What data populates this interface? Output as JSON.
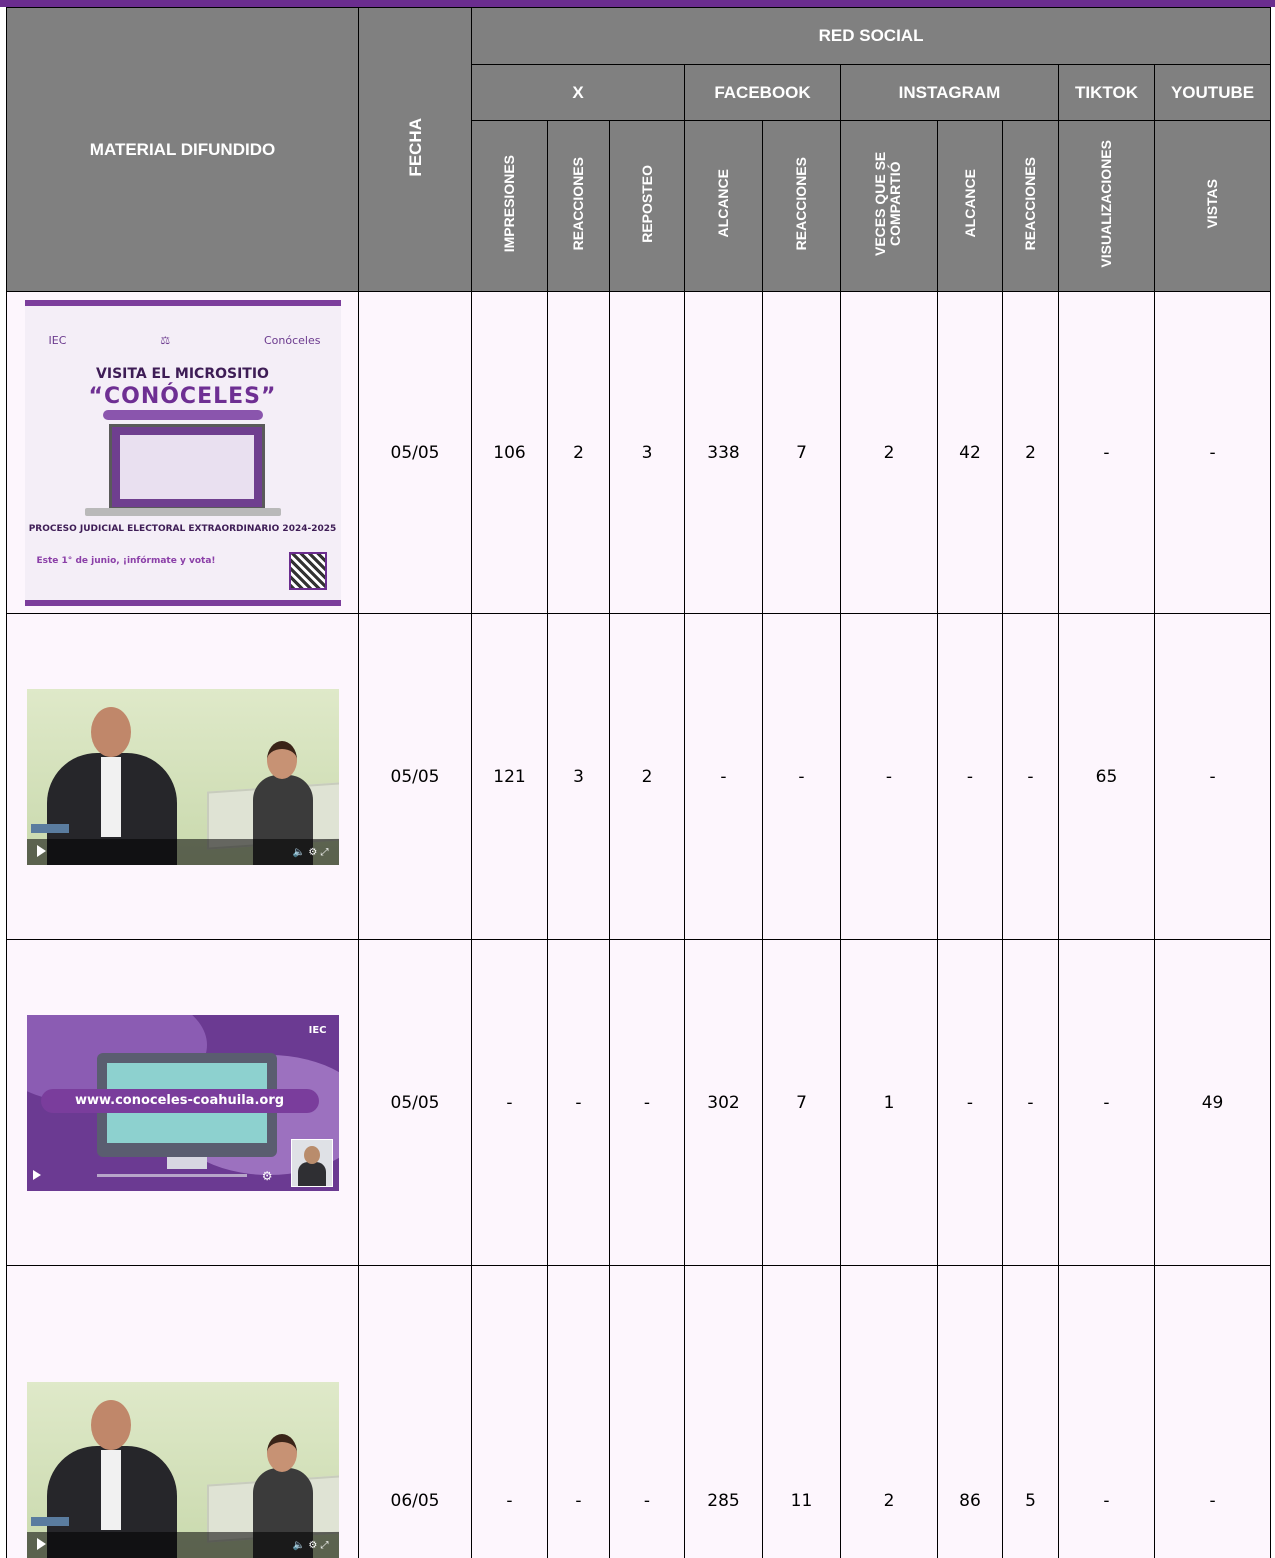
{
  "header": {
    "material": "MATERIAL DIFUNDIDO",
    "fecha": "FECHA",
    "red_social": "RED SOCIAL",
    "networks": {
      "x": "X",
      "facebook": "FACEBOOK",
      "instagram": "INSTAGRAM",
      "tiktok": "TIKTOK",
      "youtube": "YOUTUBE"
    },
    "metrics": {
      "x_impresiones": "IMPRESIONES",
      "x_reacciones": "REACCIONES",
      "x_reposteo": "REPOSTEO",
      "fb_alcance": "ALCANCE",
      "fb_reacciones": "REACCIONES",
      "ig_compartio": "VECES QUE SE COMPARTIÓ",
      "ig_alcance": "ALCANCE",
      "ig_reacciones": "REACCIONES",
      "tt_visualizaciones": "VISUALIZACIONES",
      "yt_vistas": "VISTAS"
    }
  },
  "thumbs": {
    "poster": {
      "logo_iec": "IEC",
      "logo_conoceles": "Conóceles",
      "line1": "VISITA EL MICROSITIO",
      "line2": "“CONÓCELES”",
      "line3": "PROCESO JUDICIAL ELECTORAL EXTRAORDINARIO 2024-2025",
      "line4": "Este 1° de junio, ¡infórmate y vota!"
    },
    "purple_video": {
      "url": "www.conoceles-coahuila.org",
      "logo": "IEC"
    }
  },
  "rows": [
    {
      "fecha": "05/05",
      "x_impresiones": "106",
      "x_reacciones": "2",
      "x_reposteo": "3",
      "fb_alcance": "338",
      "fb_reacciones": "7",
      "ig_compartio": "2",
      "ig_alcance": "42",
      "ig_reacciones": "2",
      "tt_visualizaciones": "-",
      "yt_vistas": "-"
    },
    {
      "fecha": "05/05",
      "x_impresiones": "121",
      "x_reacciones": "3",
      "x_reposteo": "2",
      "fb_alcance": "-",
      "fb_reacciones": "-",
      "ig_compartio": "-",
      "ig_alcance": "-",
      "ig_reacciones": "-",
      "tt_visualizaciones": "65",
      "yt_vistas": "-"
    },
    {
      "fecha": "05/05",
      "x_impresiones": "-",
      "x_reacciones": "-",
      "x_reposteo": "-",
      "fb_alcance": "302",
      "fb_reacciones": "7",
      "ig_compartio": "1",
      "ig_alcance": "-",
      "ig_reacciones": "-",
      "tt_visualizaciones": "-",
      "yt_vistas": "49"
    },
    {
      "fecha": "06/05",
      "x_impresiones": "-",
      "x_reacciones": "-",
      "x_reposteo": "-",
      "fb_alcance": "285",
      "fb_reacciones": "11",
      "ig_compartio": "2",
      "ig_alcance": "86",
      "ig_reacciones": "5",
      "tt_visualizaciones": "-",
      "yt_vistas": "-"
    }
  ]
}
